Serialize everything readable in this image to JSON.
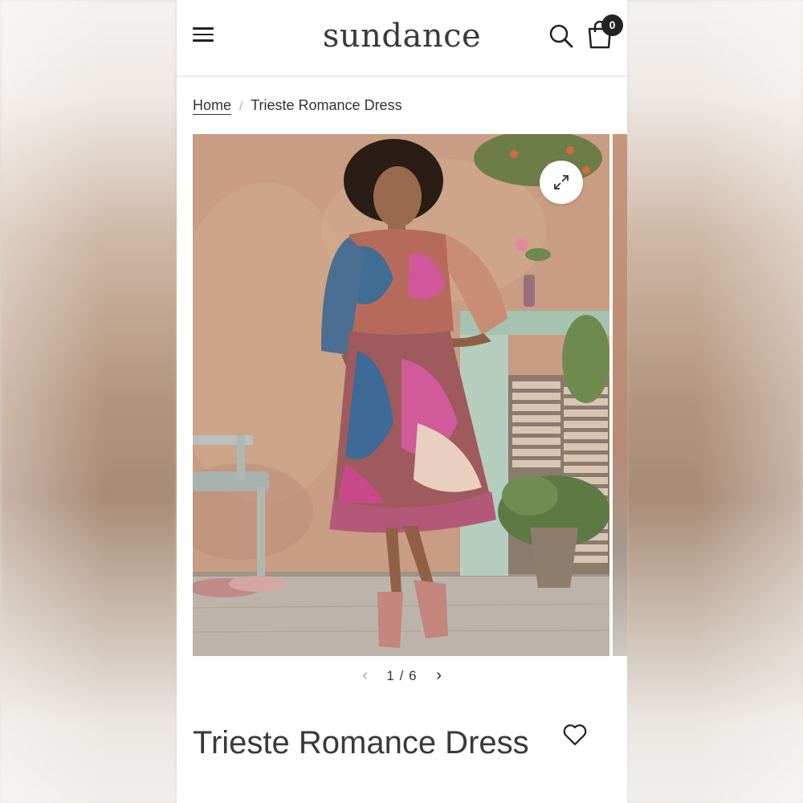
{
  "header": {
    "logo": "sundance",
    "cart_count": "0"
  },
  "breadcrumb": {
    "home": "Home",
    "separator": "/",
    "current": "Trieste Romance Dress"
  },
  "gallery": {
    "current": "1",
    "total": "6",
    "separator": "/"
  },
  "product": {
    "title": "Trieste Romance Dress"
  },
  "icons": {
    "menu": "menu-icon",
    "search": "search-icon",
    "cart": "shopping-bag-icon",
    "zoom": "expand-icon",
    "prev": "chevron-left-icon",
    "next": "chevron-right-icon",
    "wishlist": "heart-icon"
  },
  "colors": {
    "text": "#3a3a3a",
    "badge": "#222222",
    "background": "#ffffff"
  }
}
